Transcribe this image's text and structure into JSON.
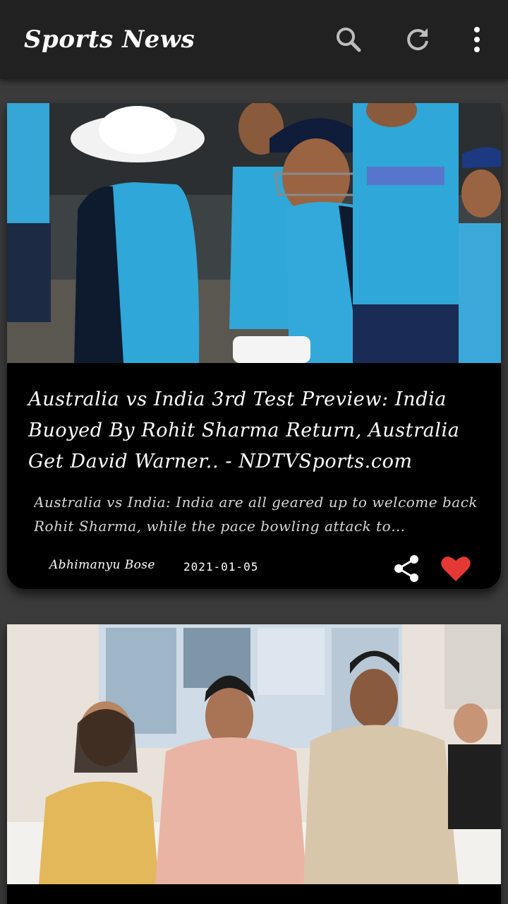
{
  "app_bar": {
    "title": "Sports News",
    "actions": [
      {
        "icon": "search-icon"
      },
      {
        "icon": "refresh-icon"
      },
      {
        "icon": "more-vert-icon"
      }
    ]
  },
  "articles": [
    {
      "image_desc_icon": "cricket-team-photo",
      "title": "Australia vs India 3rd Test Preview: India Buoyed By Rohit Sharma Return, Australia Get David Warner.. - NDTVSports.com",
      "description": "Australia vs India: India are all geared up to welcome back Rohit Sharma, while the pace bowling attack to…",
      "author": "Abhimanyu Bose",
      "date": "2021-01-05",
      "liked": true
    },
    {
      "image_desc_icon": "players-group-photo"
    }
  ],
  "colors": {
    "app_bar": "#212121",
    "background": "#3b3b3b",
    "card": "#000000",
    "like": "#e53935"
  }
}
